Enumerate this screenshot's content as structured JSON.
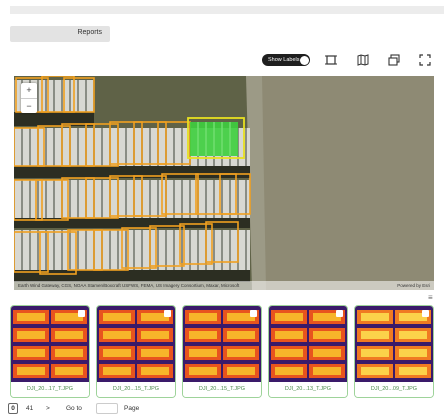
{
  "reports": {
    "label": "Reports"
  },
  "toolbar": {
    "show_labels": "Show Labels",
    "icons": [
      "frame-icon",
      "map-book-icon",
      "layers-icon",
      "fullscreen-icon"
    ]
  },
  "map": {
    "zoom_in": "+",
    "zoom_out": "−",
    "attribution": "Earth Wind Gateway, CGS, NOAA Stamen/Boxcraft USFWS, FEMA, US Imagery Consortium, Maxar, Microsoft",
    "powered_by": "Powered by Esri",
    "colors": {
      "panel_outline": "#f0a020",
      "selected_fill": "#3ecf3e",
      "selected_outline": "#e8e020"
    }
  },
  "thumbnails": [
    {
      "caption": "DJI_20...17_T.JPG"
    },
    {
      "caption": "DJI_20...15_T.JPG"
    },
    {
      "caption": "DJI_20...15_T.JPG"
    },
    {
      "caption": "DJI_20...13_T.JPG"
    },
    {
      "caption": "DJI_20...09_T.JPG"
    }
  ],
  "pagination": {
    "current": "0",
    "total": "41",
    "next": ">",
    "goto_label": "Go to",
    "page_label": "Page"
  }
}
